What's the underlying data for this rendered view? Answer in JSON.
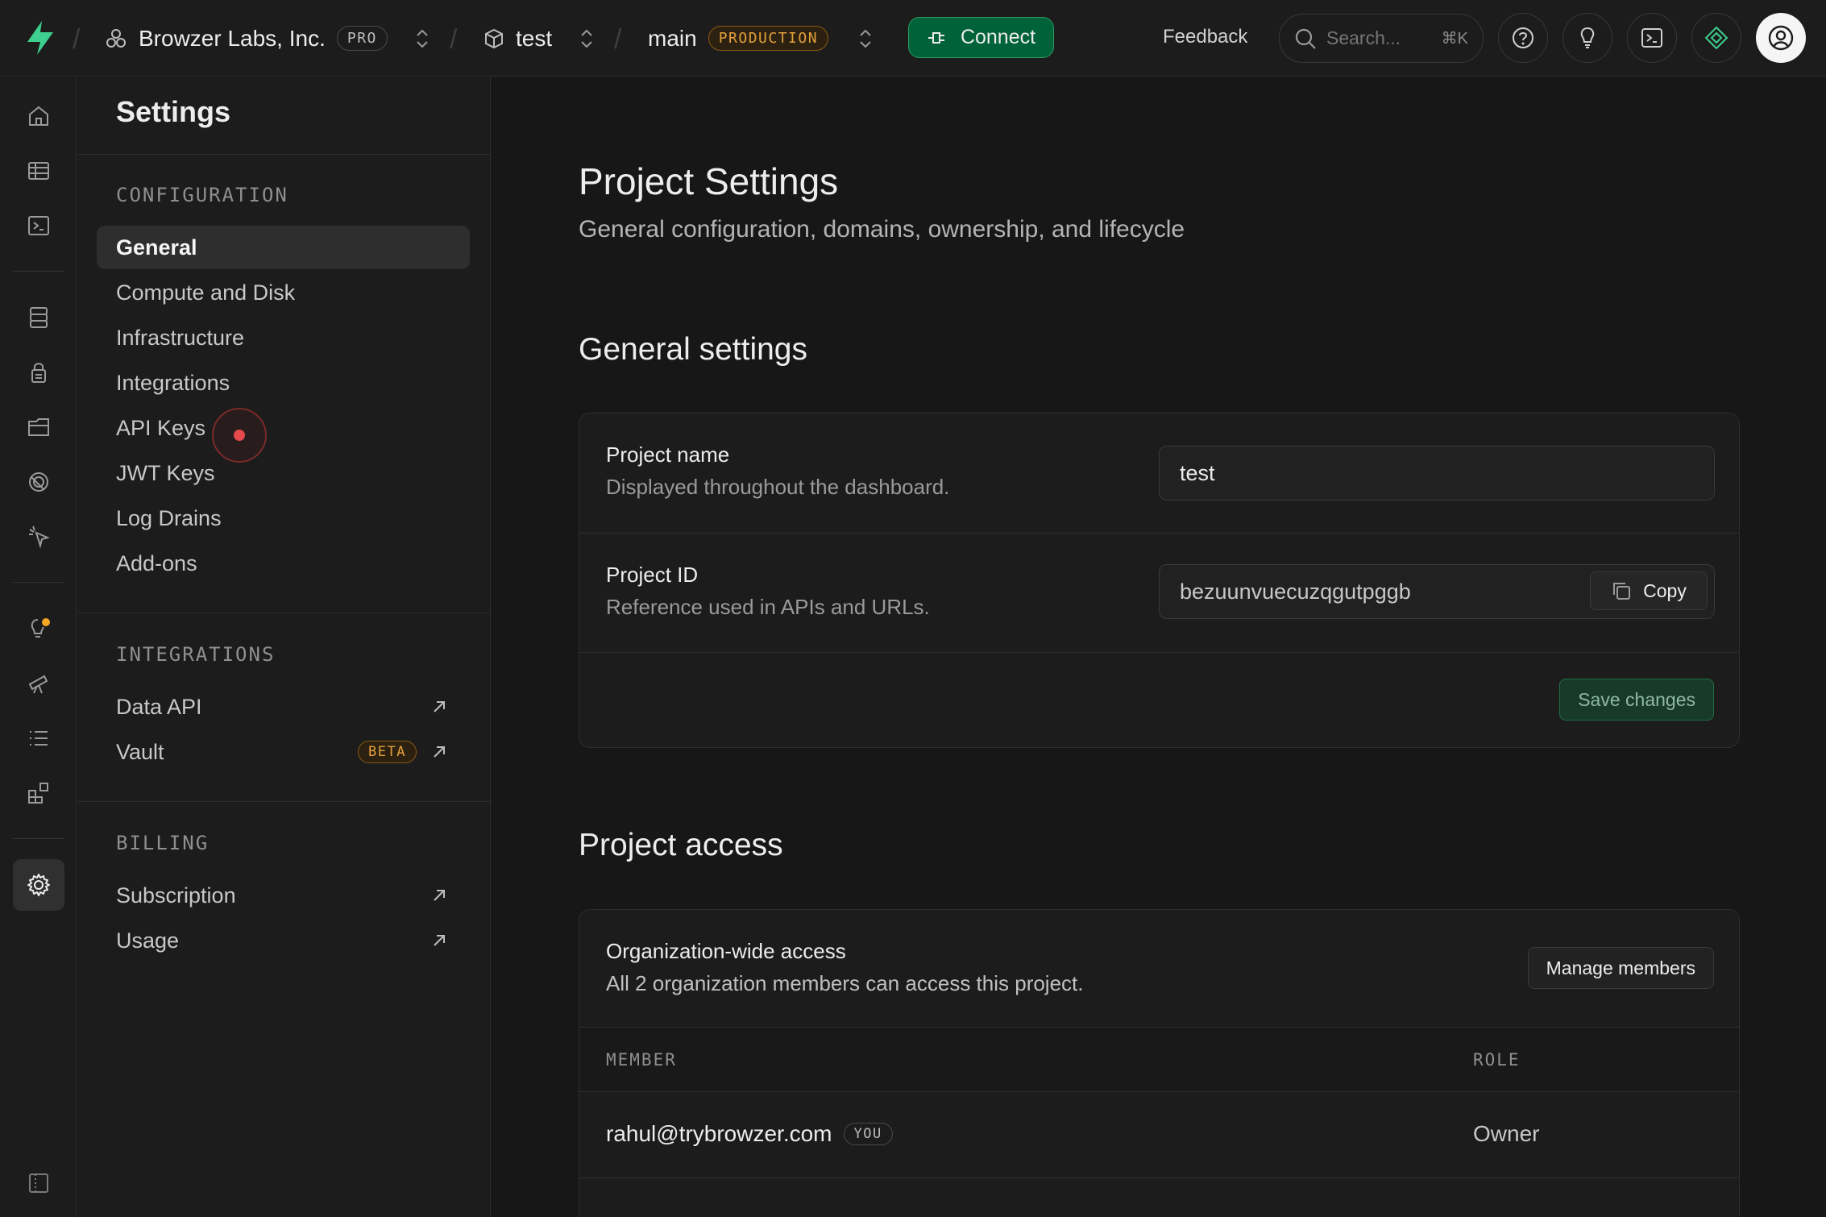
{
  "topbar": {
    "org_name": "Browzer Labs, Inc.",
    "plan_badge": "PRO",
    "project_name": "test",
    "branch_name": "main",
    "env_badge": "PRODUCTION",
    "connect_label": "Connect",
    "feedback_label": "Feedback",
    "search_placeholder": "Search...",
    "search_shortcut": "⌘K"
  },
  "sidebar": {
    "title": "Settings",
    "sections": [
      {
        "heading": "CONFIGURATION",
        "items": [
          "General",
          "Compute and Disk",
          "Infrastructure",
          "Integrations",
          "API Keys",
          "JWT Keys",
          "Log Drains",
          "Add-ons"
        ]
      },
      {
        "heading": "INTEGRATIONS",
        "items": [
          "Data API",
          "Vault"
        ],
        "vault_badge": "BETA"
      },
      {
        "heading": "BILLING",
        "items": [
          "Subscription",
          "Usage"
        ]
      }
    ],
    "active_item": "General"
  },
  "main": {
    "title": "Project Settings",
    "subtitle": "General configuration, domains, ownership, and lifecycle",
    "general": {
      "title": "General settings",
      "project_name_label": "Project name",
      "project_name_desc": "Displayed throughout the dashboard.",
      "project_name_value": "test",
      "project_id_label": "Project ID",
      "project_id_desc": "Reference used in APIs and URLs.",
      "project_id_value": "bezuunvuecuzqgutpggb",
      "copy_label": "Copy",
      "save_label": "Save changes"
    },
    "access": {
      "title": "Project access",
      "org_access_label": "Organization-wide access",
      "org_access_desc": "All 2 organization members can access this project.",
      "manage_label": "Manage members",
      "col_member": "MEMBER",
      "col_role": "ROLE",
      "members": [
        {
          "email": "rahul@trybrowzer.com",
          "you": "YOU",
          "role": "Owner"
        }
      ]
    }
  },
  "colors": {
    "accent_green": "#006239",
    "warning_orange": "#e3a03a",
    "background": "#171717"
  }
}
